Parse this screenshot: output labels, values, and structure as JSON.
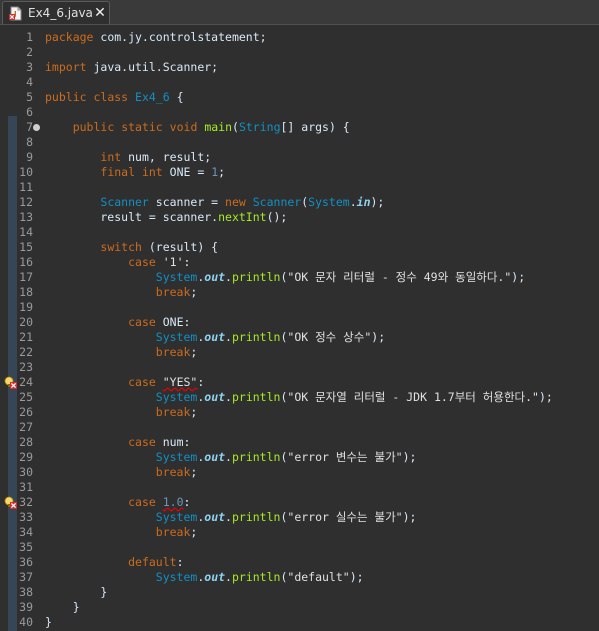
{
  "tab": {
    "title": "Ex4_6.java",
    "close": "✕",
    "icon": "java-file-error-icon"
  },
  "colors": {
    "background": "#2f2f2f",
    "keyword": "#cc6c1d",
    "class": "#1290c3",
    "method": "#a7ec21",
    "field": "#8dd2f0",
    "number": "#6897bb",
    "string": "#e0e0e0",
    "error_underline": "#e00000"
  },
  "code_lines": [
    {
      "n": "1",
      "t": [
        [
          "kw",
          "package"
        ],
        [
          "plain",
          " com.jy.controlstatement;"
        ]
      ]
    },
    {
      "n": "2",
      "t": []
    },
    {
      "n": "3",
      "t": [
        [
          "kw",
          "import"
        ],
        [
          "plain",
          " java.util.Scanner;"
        ]
      ]
    },
    {
      "n": "4",
      "t": []
    },
    {
      "n": "5",
      "t": [
        [
          "kw",
          "public"
        ],
        [
          "plain",
          " "
        ],
        [
          "kw",
          "class"
        ],
        [
          "plain",
          " "
        ],
        [
          "cls",
          "Ex4_6"
        ],
        [
          "plain",
          " {"
        ]
      ]
    },
    {
      "n": "6",
      "t": []
    },
    {
      "n": "7",
      "fold": true,
      "t": [
        [
          "plain",
          "    "
        ],
        [
          "kw",
          "public"
        ],
        [
          "plain",
          " "
        ],
        [
          "kw",
          "static"
        ],
        [
          "plain",
          " "
        ],
        [
          "kw",
          "void"
        ],
        [
          "plain",
          " "
        ],
        [
          "mth",
          "main"
        ],
        [
          "plain",
          "("
        ],
        [
          "cls",
          "String"
        ],
        [
          "plain",
          "[] args) {"
        ]
      ]
    },
    {
      "n": "8",
      "t": []
    },
    {
      "n": "9",
      "t": [
        [
          "plain",
          "        "
        ],
        [
          "kw",
          "int"
        ],
        [
          "plain",
          " num, result;"
        ]
      ]
    },
    {
      "n": "10",
      "t": [
        [
          "plain",
          "        "
        ],
        [
          "kw",
          "final"
        ],
        [
          "plain",
          " "
        ],
        [
          "kw",
          "int"
        ],
        [
          "plain",
          " ONE = "
        ],
        [
          "num",
          "1"
        ],
        [
          "plain",
          ";"
        ]
      ]
    },
    {
      "n": "11",
      "t": []
    },
    {
      "n": "12",
      "t": [
        [
          "plain",
          "        "
        ],
        [
          "cls",
          "Scanner"
        ],
        [
          "plain",
          " scanner = "
        ],
        [
          "kw",
          "new"
        ],
        [
          "plain",
          " "
        ],
        [
          "cls",
          "Scanner"
        ],
        [
          "plain",
          "("
        ],
        [
          "cls",
          "System"
        ],
        [
          "plain",
          "."
        ],
        [
          "fld",
          "in"
        ],
        [
          "plain",
          ");"
        ]
      ]
    },
    {
      "n": "13",
      "t": [
        [
          "plain",
          "        result = scanner."
        ],
        [
          "mth",
          "nextInt"
        ],
        [
          "plain",
          "();"
        ]
      ]
    },
    {
      "n": "14",
      "t": []
    },
    {
      "n": "15",
      "t": [
        [
          "plain",
          "        "
        ],
        [
          "kw",
          "switch"
        ],
        [
          "plain",
          " (result) {"
        ]
      ]
    },
    {
      "n": "16",
      "t": [
        [
          "plain",
          "            "
        ],
        [
          "kw",
          "case"
        ],
        [
          "plain",
          " "
        ],
        [
          "str",
          "'1'"
        ],
        [
          "plain",
          ":"
        ]
      ]
    },
    {
      "n": "17",
      "t": [
        [
          "plain",
          "                "
        ],
        [
          "cls",
          "System"
        ],
        [
          "plain",
          "."
        ],
        [
          "fld",
          "out"
        ],
        [
          "plain",
          "."
        ],
        [
          "mth",
          "println"
        ],
        [
          "plain",
          "("
        ],
        [
          "str",
          "\"OK 문자 리터럴 - 정수 49와 동일하다.\""
        ],
        [
          "plain",
          ");"
        ]
      ]
    },
    {
      "n": "18",
      "t": [
        [
          "plain",
          "                "
        ],
        [
          "kw",
          "break"
        ],
        [
          "plain",
          ";"
        ]
      ]
    },
    {
      "n": "19",
      "t": []
    },
    {
      "n": "20",
      "t": [
        [
          "plain",
          "            "
        ],
        [
          "kw",
          "case"
        ],
        [
          "plain",
          " ONE:"
        ]
      ]
    },
    {
      "n": "21",
      "t": [
        [
          "plain",
          "                "
        ],
        [
          "cls",
          "System"
        ],
        [
          "plain",
          "."
        ],
        [
          "fld",
          "out"
        ],
        [
          "plain",
          "."
        ],
        [
          "mth",
          "println"
        ],
        [
          "plain",
          "("
        ],
        [
          "str",
          "\"OK 정수 상수\""
        ],
        [
          "plain",
          ");"
        ]
      ]
    },
    {
      "n": "22",
      "t": [
        [
          "plain",
          "                "
        ],
        [
          "kw",
          "break"
        ],
        [
          "plain",
          ";"
        ]
      ]
    },
    {
      "n": "23",
      "t": []
    },
    {
      "n": "24",
      "marker": true,
      "t": [
        [
          "plain",
          "            "
        ],
        [
          "kw",
          "case"
        ],
        [
          "plain",
          " "
        ],
        [
          "str err",
          "\"YES\""
        ],
        [
          "plain",
          ":"
        ]
      ]
    },
    {
      "n": "25",
      "t": [
        [
          "plain",
          "                "
        ],
        [
          "cls",
          "System"
        ],
        [
          "plain",
          "."
        ],
        [
          "fld",
          "out"
        ],
        [
          "plain",
          "."
        ],
        [
          "mth",
          "println"
        ],
        [
          "plain",
          "("
        ],
        [
          "str",
          "\"OK 문자열 리터럴 - JDK 1.7부터 허용한다.\""
        ],
        [
          "plain",
          ");"
        ]
      ]
    },
    {
      "n": "26",
      "t": [
        [
          "plain",
          "                "
        ],
        [
          "kw",
          "break"
        ],
        [
          "plain",
          ";"
        ]
      ]
    },
    {
      "n": "27",
      "t": []
    },
    {
      "n": "28",
      "t": [
        [
          "plain",
          "            "
        ],
        [
          "kw",
          "case"
        ],
        [
          "plain",
          " num:"
        ]
      ]
    },
    {
      "n": "29",
      "t": [
        [
          "plain",
          "                "
        ],
        [
          "cls",
          "System"
        ],
        [
          "plain",
          "."
        ],
        [
          "fld",
          "out"
        ],
        [
          "plain",
          "."
        ],
        [
          "mth",
          "println"
        ],
        [
          "plain",
          "("
        ],
        [
          "str",
          "\"error 변수는 불가\""
        ],
        [
          "plain",
          ");"
        ]
      ]
    },
    {
      "n": "30",
      "t": [
        [
          "plain",
          "                "
        ],
        [
          "kw",
          "break"
        ],
        [
          "plain",
          ";"
        ]
      ]
    },
    {
      "n": "31",
      "t": []
    },
    {
      "n": "32",
      "marker": true,
      "t": [
        [
          "plain",
          "            "
        ],
        [
          "kw",
          "case"
        ],
        [
          "plain",
          " "
        ],
        [
          "num err",
          "1.0"
        ],
        [
          "plain",
          ":"
        ]
      ]
    },
    {
      "n": "33",
      "t": [
        [
          "plain",
          "                "
        ],
        [
          "cls",
          "System"
        ],
        [
          "plain",
          "."
        ],
        [
          "fld",
          "out"
        ],
        [
          "plain",
          "."
        ],
        [
          "mth",
          "println"
        ],
        [
          "plain",
          "("
        ],
        [
          "str",
          "\"error 실수는 불가\""
        ],
        [
          "plain",
          ");"
        ]
      ]
    },
    {
      "n": "34",
      "t": [
        [
          "plain",
          "                "
        ],
        [
          "kw",
          "break"
        ],
        [
          "plain",
          ";"
        ]
      ]
    },
    {
      "n": "35",
      "t": []
    },
    {
      "n": "36",
      "t": [
        [
          "plain",
          "            "
        ],
        [
          "kw",
          "default"
        ],
        [
          "plain",
          ":"
        ]
      ]
    },
    {
      "n": "37",
      "t": [
        [
          "plain",
          "                "
        ],
        [
          "cls",
          "System"
        ],
        [
          "plain",
          "."
        ],
        [
          "fld",
          "out"
        ],
        [
          "plain",
          "."
        ],
        [
          "mth",
          "println"
        ],
        [
          "plain",
          "("
        ],
        [
          "str",
          "\"default\""
        ],
        [
          "plain",
          ");"
        ]
      ]
    },
    {
      "n": "38",
      "t": [
        [
          "plain",
          "        }"
        ]
      ]
    },
    {
      "n": "39",
      "t": [
        [
          "plain",
          "    }"
        ]
      ]
    },
    {
      "n": "40",
      "t": [
        [
          "plain",
          "}"
        ]
      ]
    }
  ]
}
